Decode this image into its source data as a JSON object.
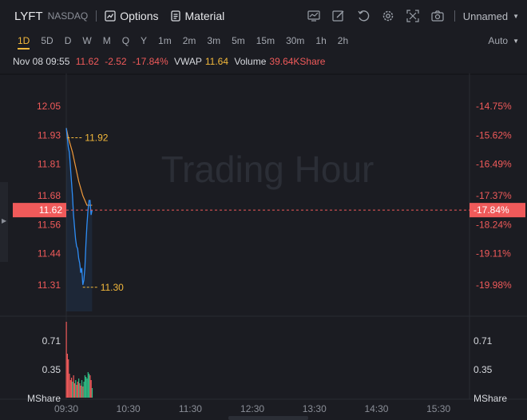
{
  "topbar": {
    "ticker": "LYFT",
    "exchange": "NASDAQ",
    "options_label": "Options",
    "material_label": "Material",
    "layout_name": "Unnamed",
    "tool_icons": [
      "indicator-chart-icon",
      "draw-pen-icon",
      "undo-refresh-icon",
      "settings-gear-icon",
      "fullscreen-icon",
      "camera-snapshot-icon"
    ]
  },
  "periods": [
    {
      "label": "1D",
      "active": true
    },
    {
      "label": "5D"
    },
    {
      "label": "D"
    },
    {
      "label": "W"
    },
    {
      "label": "M"
    },
    {
      "label": "Q"
    },
    {
      "label": "Y"
    },
    {
      "label": "1m"
    },
    {
      "label": "2m"
    },
    {
      "label": "3m"
    },
    {
      "label": "5m"
    },
    {
      "label": "15m"
    },
    {
      "label": "30m"
    },
    {
      "label": "1h"
    },
    {
      "label": "2h"
    }
  ],
  "scale_mode": "Auto",
  "info": {
    "datetime": "Nov 08 09:55",
    "price": "11.62",
    "change": "-2.52",
    "change_pct": "-17.84%",
    "vwap_label": "VWAP",
    "vwap_value": "11.64",
    "volume_label": "Volume",
    "volume_value": "39.64KShare"
  },
  "watermark": "Trading Hour",
  "colors": {
    "background": "#1b1c22",
    "up": "#2ebd85",
    "down": "#f05a5a",
    "price_line": "#2e8df5",
    "vwap_line": "#f09a3b",
    "marker": "#f3b83b"
  },
  "chart_data": {
    "type": "line",
    "price_axis": {
      "ticks": [
        "12.05",
        "11.93",
        "11.81",
        "11.68",
        "11.56",
        "11.44",
        "11.31"
      ],
      "current": "11.62",
      "tick_values": [
        12.05,
        11.93,
        11.81,
        11.68,
        11.56,
        11.44,
        11.31
      ],
      "ylim": [
        11.2,
        12.16
      ]
    },
    "percent_axis": {
      "ticks": [
        "-14.75%",
        "-15.62%",
        "-16.49%",
        "-17.37%",
        "-18.24%",
        "-19.11%",
        "-19.98%"
      ],
      "current": "-17.84%"
    },
    "volume_axis": {
      "ticks": [
        "0.71",
        "0.35"
      ],
      "unit": "MShare",
      "tick_values": [
        0.71,
        0.35
      ],
      "ylim": [
        0,
        1.0
      ]
    },
    "time_axis": {
      "ticks": [
        "09:30",
        "10:30",
        "11:30",
        "12:30",
        "13:30",
        "14:30",
        "15:30"
      ],
      "session_minutes": 390,
      "tick_minutes": [
        0,
        60,
        120,
        180,
        240,
        300,
        360
      ]
    },
    "high_marker": "11.92",
    "low_marker": "11.30",
    "high_value": 11.92,
    "low_value": 11.3,
    "price_series": {
      "minutes": [
        0,
        1,
        2,
        3,
        4,
        5,
        6,
        7,
        8,
        9,
        10,
        11,
        12,
        13,
        14,
        15,
        16,
        17,
        18,
        19,
        20,
        21,
        22,
        23,
        24,
        25
      ],
      "values": [
        11.96,
        11.92,
        11.88,
        11.86,
        11.8,
        11.74,
        11.68,
        11.6,
        11.55,
        11.5,
        11.47,
        11.46,
        11.42,
        11.4,
        11.36,
        11.38,
        11.31,
        11.33,
        11.38,
        11.48,
        11.56,
        11.62,
        11.66,
        11.66,
        11.6,
        11.62
      ]
    },
    "vwap_series": {
      "minutes": [
        0,
        2,
        4,
        6,
        8,
        10,
        12,
        14,
        16,
        18,
        20,
        22,
        25
      ],
      "values": [
        11.96,
        11.92,
        11.89,
        11.86,
        11.82,
        11.78,
        11.74,
        11.71,
        11.68,
        11.66,
        11.64,
        11.64,
        11.64
      ]
    },
    "volume_series": {
      "values": [
        0.95,
        0.55,
        0.48,
        0.3,
        0.22,
        0.25,
        0.2,
        0.28,
        0.18,
        0.22,
        0.16,
        0.2,
        0.24,
        0.18,
        0.15,
        0.22,
        0.14,
        0.2,
        0.28,
        0.26,
        0.24,
        0.32,
        0.3,
        0.28,
        0.22,
        0.12
      ],
      "direction": [
        "down",
        "down",
        "down",
        "down",
        "down",
        "down",
        "up",
        "down",
        "down",
        "up",
        "down",
        "down",
        "up",
        "down",
        "down",
        "up",
        "down",
        "up",
        "up",
        "up",
        "up",
        "up",
        "up",
        "down",
        "down",
        "up"
      ]
    }
  }
}
